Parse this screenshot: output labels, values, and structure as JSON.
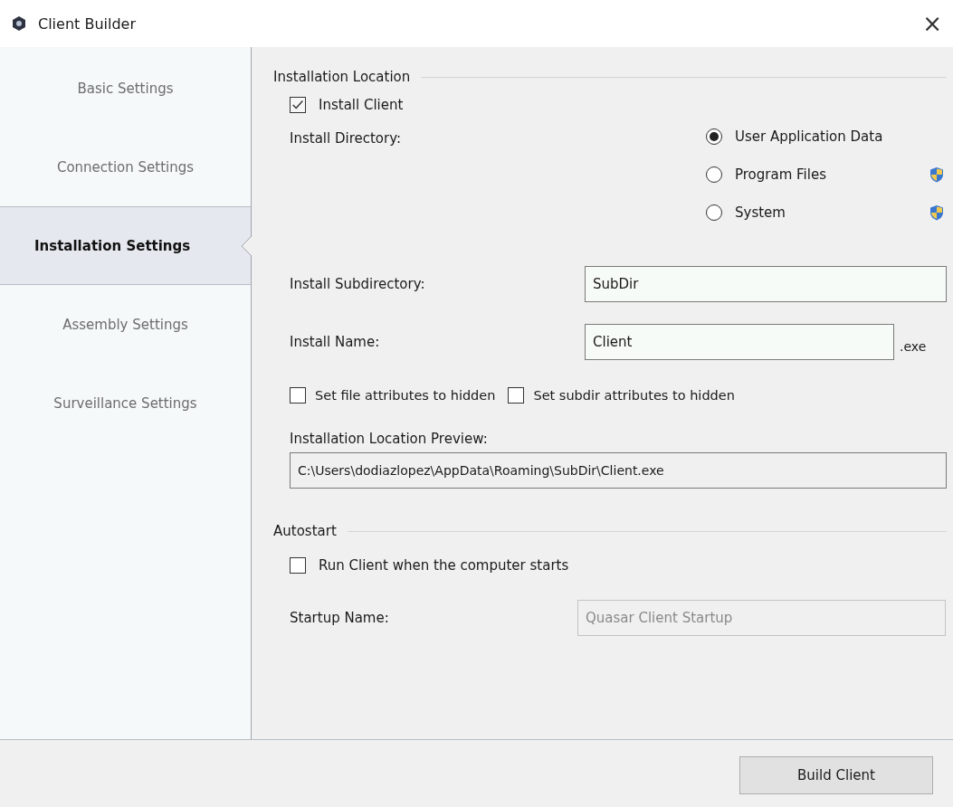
{
  "window": {
    "title": "Client Builder",
    "close": "×"
  },
  "sidebar": {
    "items": [
      {
        "label": "Basic Settings",
        "selected": false
      },
      {
        "label": "Connection Settings",
        "selected": false
      },
      {
        "label": "Installation Settings",
        "selected": true
      },
      {
        "label": "Assembly Settings",
        "selected": false
      },
      {
        "label": "Surveillance Settings",
        "selected": false
      }
    ]
  },
  "installation_location": {
    "title": "Installation Location",
    "install_client": {
      "label": "Install Client",
      "checked": true
    },
    "install_directory": {
      "label": "Install Directory:",
      "options": [
        {
          "label": "User Application Data",
          "selected": true,
          "admin": false
        },
        {
          "label": "Program Files",
          "selected": false,
          "admin": true
        },
        {
          "label": "System",
          "selected": false,
          "admin": true
        }
      ]
    },
    "install_subdirectory": {
      "label": "Install Subdirectory:",
      "value": "SubDir"
    },
    "install_name": {
      "label": "Install Name:",
      "value": "Client",
      "suffix": ".exe"
    },
    "hidden_options": [
      {
        "label": "Set file attributes to hidden",
        "checked": false
      },
      {
        "label": "Set subdir attributes to hidden",
        "checked": false
      }
    ],
    "preview": {
      "label": "Installation Location Preview:",
      "value": "C:\\Users\\dodiazlopez\\AppData\\Roaming\\SubDir\\Client.exe"
    }
  },
  "autostart": {
    "title": "Autostart",
    "run_on_start": {
      "label": "Run Client when the computer starts",
      "checked": false
    },
    "startup_name": {
      "label": "Startup Name:",
      "value": "Quasar Client Startup",
      "disabled": true
    }
  },
  "buttons": [
    "Build Client"
  ]
}
